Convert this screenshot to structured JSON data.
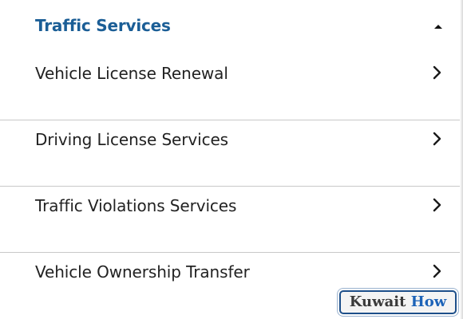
{
  "section": {
    "title": "Traffic Services",
    "collapse_icon": "caret-up-icon"
  },
  "items": [
    {
      "label": "Vehicle License Renewal",
      "icon": "chevron-right-icon"
    },
    {
      "label": "Driving License Services",
      "icon": "chevron-right-icon"
    },
    {
      "label": "Traffic Violations Services",
      "icon": "chevron-right-icon"
    },
    {
      "label": "Vehicle Ownership Transfer",
      "icon": "chevron-right-icon"
    }
  ],
  "watermark": {
    "word1": "Kuwait",
    "word2": "How"
  },
  "colors": {
    "title": "#1b5e96",
    "text": "#222222",
    "divider": "#c8c8c8",
    "watermark_border": "#1d4f8a",
    "watermark_accent": "#1d63b8"
  }
}
